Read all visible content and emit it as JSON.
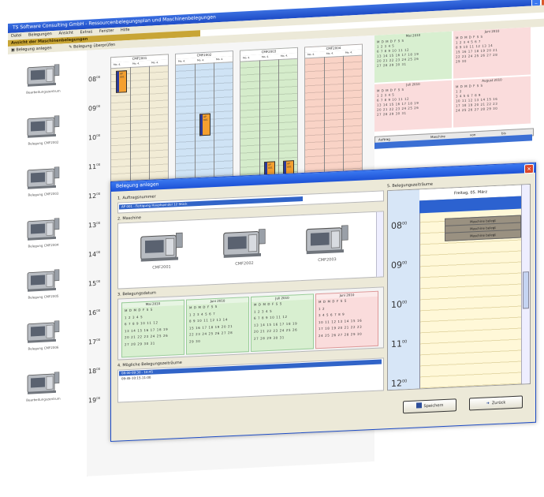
{
  "main_window": {
    "title": "TS Software Consulting GmbH - Ressourcenbelegungsplan und Maschinenbelegungen",
    "menu": [
      "Datei",
      "Belegungen",
      "Ansicht",
      "Extras",
      "Fenster",
      "Hilfe"
    ],
    "section_header": "Ansicht der Maschinenbelegungen",
    "toolbar": [
      "Belegung anlegen",
      "Belegung überprüfen"
    ],
    "machines": [
      {
        "label": "Bearbeitungszentrum"
      },
      {
        "label": "Belegung CMF2002"
      },
      {
        "label": "Belegung CMF2003"
      },
      {
        "label": "Belegung CMF2004"
      },
      {
        "label": "Belegung CMF2005"
      },
      {
        "label": "Belegung CMF2006"
      },
      {
        "label": "Bearbeitungszentrum"
      }
    ],
    "hours": [
      "08",
      "09",
      "10",
      "11",
      "12",
      "13",
      "14",
      "15",
      "16",
      "17",
      "18",
      "19"
    ],
    "hour_suffix": "00",
    "machine_columns": [
      {
        "name": "CMF2001",
        "color": "#f2ecd6"
      },
      {
        "name": "CMF2002",
        "color": "#cfe3f5"
      },
      {
        "name": "CMF2003",
        "color": "#d5eccb"
      },
      {
        "name": "CMF2004",
        "color": "#f9d3c6"
      }
    ],
    "subcol_label": "Mo. 4.",
    "booking_label": "AP 001",
    "mini_calendars": [
      {
        "title": "Mai 2010",
        "color": "#d8efd0",
        "rows": [
          "M D M D F S S",
          "   1 2 3 4 5",
          "6 7 8 9 10 11 12",
          "13 14 15 16 17 18 19",
          "20 21 22 23 24 25 26",
          "27 28 29 30 31"
        ]
      },
      {
        "title": "Juni 2010",
        "color": "#fadcdc",
        "rows": [
          "M D M D F S S",
          "1 2 3 4 5 6 7",
          "8 9 10 11 12 13 14",
          "15 16 17 18 19 20 21",
          "22 23 24 25 26 27 28",
          "29 30"
        ]
      },
      {
        "title": "Juli 2010",
        "color": "#fadcdc",
        "rows": [
          "M D M D F S S",
          "  1 2 3 4 5",
          "6 7 8 9 10 11 12",
          "13 14 15 16 17 18 19",
          "20 21 22 23 24 25 26",
          "27 28 29 30 31"
        ]
      },
      {
        "title": "August 2010",
        "color": "#fadcdc",
        "rows": [
          "M D M D F S S",
          "     1 2",
          "3 4 5 6 7 8 9",
          "10 11 12 13 14 15 16",
          "17 18 19 20 21 22 23",
          "24 25 26 27 28 29 30"
        ]
      }
    ],
    "table_headers": [
      "Auftrag",
      "Maschine",
      "von",
      "bis"
    ]
  },
  "dialog": {
    "title": "Belegung anlegen",
    "section1": "1. Auftragsnummer",
    "order_selected": "AP 001 - Fertigung Hauptspindel 12 Stück",
    "section2": "2. Maschine",
    "machines": [
      {
        "label": "CMF2001"
      },
      {
        "label": "CMF2002"
      },
      {
        "label": "CMF2003"
      }
    ],
    "section3": "3. Belegungsdatum",
    "calendars": [
      {
        "title": "Mai 2010",
        "rows": [
          "M D M D F S S",
          "   1 2 3 4 5",
          "6 7 8 9 10 11 12",
          "13 14 15 16 17 18 19",
          "20 21 22 23 24 25 26",
          "27 28 29 30 31"
        ],
        "pink": false
      },
      {
        "title": "Juni 2010",
        "rows": [
          "M D M D F S S",
          "1 2 3 4 5 6 7",
          "8 9 10 11 12 13 14",
          "15 16 17 18 19 20 21",
          "22 23 24 25 26 27 28",
          "29 30"
        ],
        "pink": false
      },
      {
        "title": "Juli 2010",
        "rows": [
          "M D M D F S S",
          "  1 2 3 4 5",
          "6 7 8 9 10 11 12",
          "13 14 15 16 17 18 19",
          "20 21 22 23 24 25 26",
          "27 28 29 30 31"
        ],
        "pink": false
      },
      {
        "title": "Juni 2010",
        "rows": [
          "M D M D F S S",
          "     1 2",
          "3 4 5 6 7 8 9",
          "10 11 12 13 14 15 16",
          "17 18 19 20 21 22 23",
          "24 25 26 27 28 29 30"
        ],
        "pink": true
      }
    ],
    "section4": "4. Mögliche Belegungszeiträume",
    "slots": [
      "08:00-09:30 - 10:45",
      "09:45-10:15-11:00"
    ],
    "section5": "5. Belegungszeiträume",
    "day_header": "Freitag, 05. März",
    "day_hours": [
      "08",
      "09",
      "10",
      "11",
      "12"
    ],
    "hour_suffix": "00",
    "occupied": [
      "Maschine belegt",
      "Maschine belegt",
      "Maschine belegt"
    ],
    "btn_save": "Speichern",
    "btn_back": "Zurück"
  }
}
